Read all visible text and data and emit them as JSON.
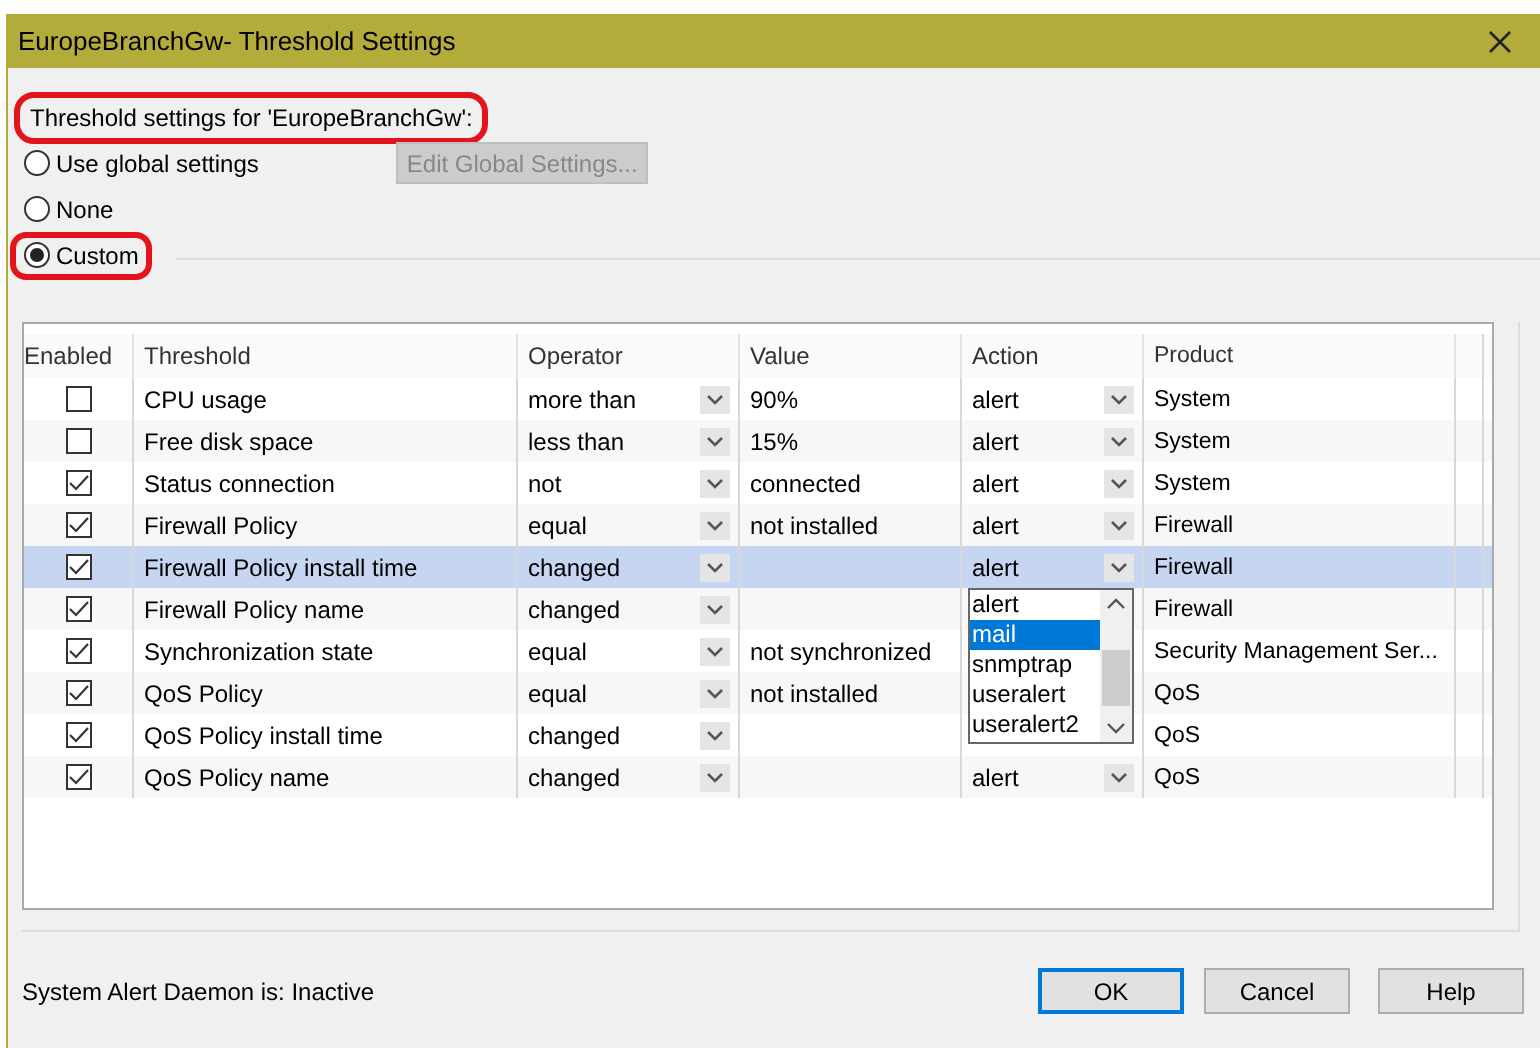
{
  "window": {
    "title": "EuropeBranchGw- Threshold Settings"
  },
  "heading": {
    "text": "Threshold settings for 'EuropeBranchGw':",
    "highlighted": true
  },
  "modes": [
    {
      "label": "Use global settings",
      "selected": false,
      "highlighted": false
    },
    {
      "label": "None",
      "selected": false,
      "highlighted": false
    },
    {
      "label": "Custom",
      "selected": true,
      "highlighted": true
    }
  ],
  "edit_global_button": {
    "label": "Edit Global Settings...",
    "disabled": true
  },
  "table": {
    "columns": [
      "Enabled",
      "Threshold",
      "Operator",
      "Value",
      "Action",
      "Product"
    ],
    "rows": [
      {
        "enabled": false,
        "threshold": "CPU usage",
        "operator": "more than",
        "value": "90%",
        "action": "alert",
        "product": "System",
        "selected": false
      },
      {
        "enabled": false,
        "threshold": "Free disk space",
        "operator": "less than",
        "value": "15%",
        "action": "alert",
        "product": "System",
        "selected": false
      },
      {
        "enabled": true,
        "threshold": "Status connection",
        "operator": "not",
        "value": "connected",
        "action": "alert",
        "product": "System",
        "selected": false
      },
      {
        "enabled": true,
        "threshold": "Firewall Policy",
        "operator": "equal",
        "value": "not installed",
        "action": "alert",
        "product": "Firewall",
        "selected": false
      },
      {
        "enabled": true,
        "threshold": "Firewall Policy install time",
        "operator": "changed",
        "action": "alert",
        "product": "Firewall",
        "selected": true,
        "dropdown": [
          {
            "label": "alert",
            "selected": false
          },
          {
            "label": "mail",
            "selected": true
          },
          {
            "label": "snmptrap",
            "selected": false
          },
          {
            "label": "useralert",
            "selected": false
          },
          {
            "label": "useralert2",
            "selected": false
          }
        ]
      },
      {
        "enabled": true,
        "threshold": "Firewall Policy name",
        "operator": "changed",
        "product": "Firewall",
        "selected": false
      },
      {
        "enabled": true,
        "threshold": "Synchronization state",
        "operator": "equal",
        "value": "not synchronized",
        "product": "Security Management Ser...",
        "selected": false
      },
      {
        "enabled": true,
        "threshold": "QoS Policy",
        "operator": "equal",
        "value": "not installed",
        "product": "QoS",
        "selected": false
      },
      {
        "enabled": true,
        "threshold": "QoS Policy install time",
        "operator": "changed",
        "product": "QoS",
        "selected": false
      },
      {
        "enabled": true,
        "threshold": "QoS Policy name",
        "operator": "changed",
        "action": "alert",
        "product": "QoS",
        "selected": false
      }
    ]
  },
  "status_bar": {
    "text": "System Alert Daemon is: Inactive"
  },
  "buttons": [
    {
      "label": "OK",
      "default": true
    },
    {
      "label": "Cancel",
      "default": false
    },
    {
      "label": "Help",
      "default": false
    }
  ]
}
